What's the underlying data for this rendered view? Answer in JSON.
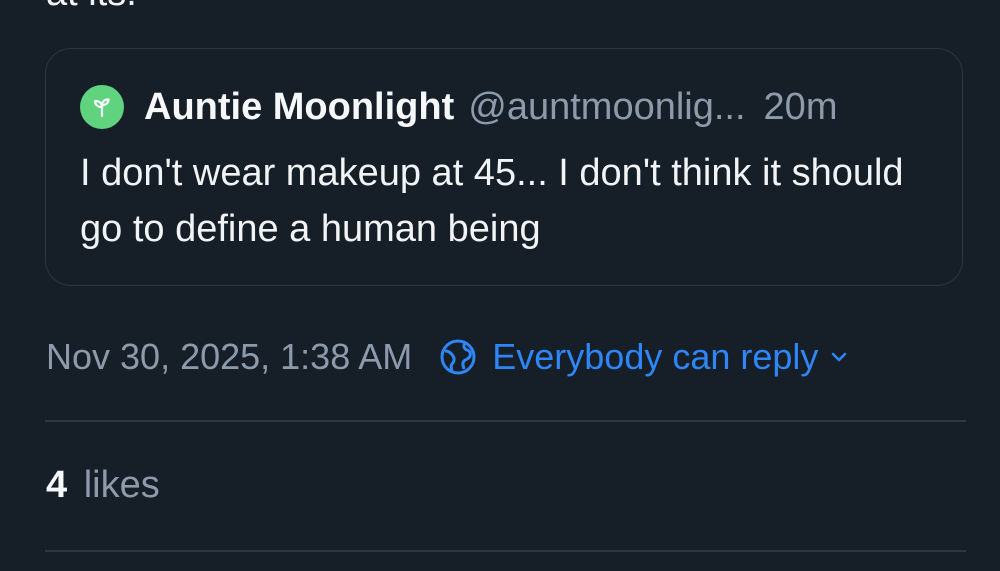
{
  "post": {
    "text_cutoff": "at its.",
    "timestamp": "Nov 30, 2025, 1:38 AM",
    "reply_setting": "Everybody can reply",
    "likes_count": "4",
    "likes_label": "likes"
  },
  "quote": {
    "author_name": "Auntie Moonlight",
    "author_handle": "@auntmoonlig...",
    "time": "20m",
    "text": "I don't wear makeup at 45... I don't think it should go to define a human being"
  },
  "icons": {
    "avatar": "sprout-icon",
    "reply_setting": "globe-icon",
    "dropdown": "chevron-down-icon"
  },
  "colors": {
    "background": "#161e27",
    "accent": "#2f86f6",
    "muted_text": "#8c9aab",
    "avatar": "#5fd37d",
    "border": "#2c3743"
  }
}
